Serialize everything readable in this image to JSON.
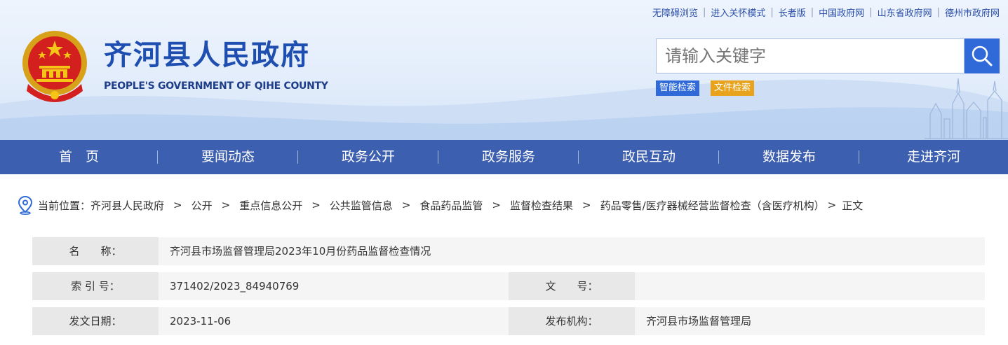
{
  "top_links": [
    "无障碍浏览",
    "进入关怀模式",
    "长者版",
    "中国政府网",
    "山东省政府网",
    "德州市政府网"
  ],
  "site": {
    "title_cn": "齐河县人民政府",
    "title_en": "PEOPLE'S GOVERNMENT OF QIHE COUNTY",
    "brand_color": "#1e4fb0"
  },
  "search": {
    "placeholder": "请输入关键字",
    "smart_search_label": "智能检索",
    "file_search_label": "文件检索",
    "button_color": "#2f6ad8"
  },
  "nav": {
    "items": [
      "首　页",
      "要闻动态",
      "政务公开",
      "政务服务",
      "政民互动",
      "数据发布",
      "走进齐河"
    ],
    "background": "#3d5fb0"
  },
  "breadcrumb": {
    "prefix": "当前位置：",
    "items": [
      "齐河县人民政府",
      "公开",
      "重点信息公开",
      "公共监管信息",
      "食品药品监管",
      "监督检查结果",
      "药品零售/医疗器械经营监督检查（含医疗机构）",
      "正文"
    ],
    "separator": ">"
  },
  "info": {
    "name_label": "名　　称：",
    "name_value": "齐河县市场监督管理局2023年10月份药品监督检查情况",
    "index_label": "索 引 号：",
    "index_value": "371402/2023_84940769",
    "doc_no_label": "文　　号：",
    "doc_no_value": "",
    "date_label": "发文日期：",
    "date_value": "2023-11-06",
    "publisher_label": "发布机构：",
    "publisher_value": "齐河县市场监督管理局"
  }
}
